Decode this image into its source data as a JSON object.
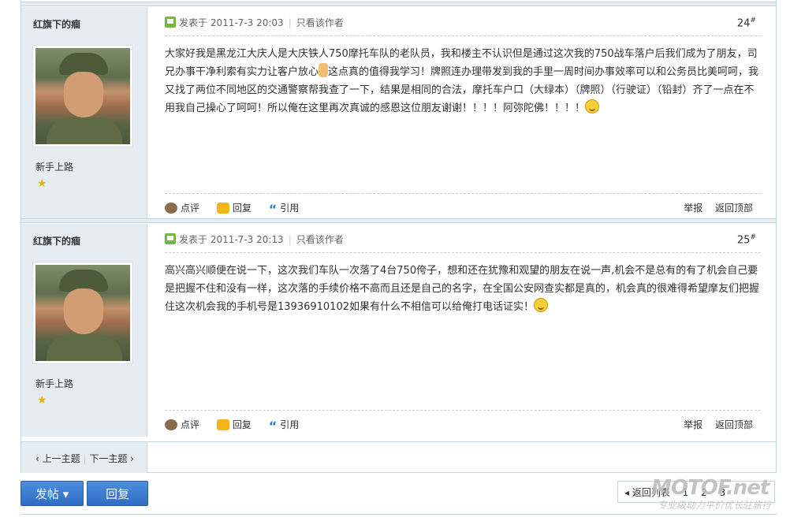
{
  "posts": [
    {
      "username": "红旗下的痼",
      "rank": "新手上路",
      "posted_label": "发表于 2011-7-3 20:03",
      "only_author": "只看该作者",
      "floor": "24",
      "floor_sup": "#",
      "body_1": "大家好我是黑龙江大庆人是大庆铁人750摩托车队的老队员，我和楼主不认识但是通过这次我的750战车落户后我们成为了朋友，司兄办事干净利索有实力让客户放心",
      "body_2": "这点真的值得我学习！牌照连办理带发到我的手里一周时间办事效率可以和公务员比美呵呵，我又找了两位不同地区的交通警察帮我查了一下，结果是相同的合法，摩托车户口（大绿本）（牌照）（行驶证）（铅封）齐了一点在不用我自己操心了呵呵！所以俺在这里再次真诚的感恩这位朋友谢谢！！！！阿弥陀佛！！！！",
      "comment": "点评",
      "reply": "回复",
      "quote": "引用",
      "report": "举报",
      "top": "返回顶部"
    },
    {
      "username": "红旗下的痼",
      "rank": "新手上路",
      "posted_label": "发表于 2011-7-3 20:13",
      "only_author": "只看该作者",
      "floor": "25",
      "floor_sup": "#",
      "body_1": "高兴高兴顺便在说一下，这次我们车队一次落了4台750侉子，想和还在犹豫和观望的朋友在说一声,机会不是总有的有了机会自己要是把握不住和没有一样，这次落的手续价格不高而且还是自己的名字，在全国公安网查实都是真的，机会真的很难得希望摩友们把握住这次机会我的手机号是13936910102如果有什么不相信可以给俺打电话证实！",
      "comment": "点评",
      "reply": "回复",
      "quote": "引用",
      "report": "举报",
      "top": "返回顶部"
    }
  ],
  "nav": {
    "prev": "‹ 上一主题",
    "next": "下一主题 ›"
  },
  "buttons": {
    "post": "发帖 ▾",
    "reply": "回复"
  },
  "pager": {
    "back": "◂ 返回列表",
    "p1": "1",
    "p2": "2",
    "p3": "3"
  },
  "watermark": {
    "logo": "MOTOF.net",
    "slogan": "专业级动力平价优长驻旅行"
  }
}
